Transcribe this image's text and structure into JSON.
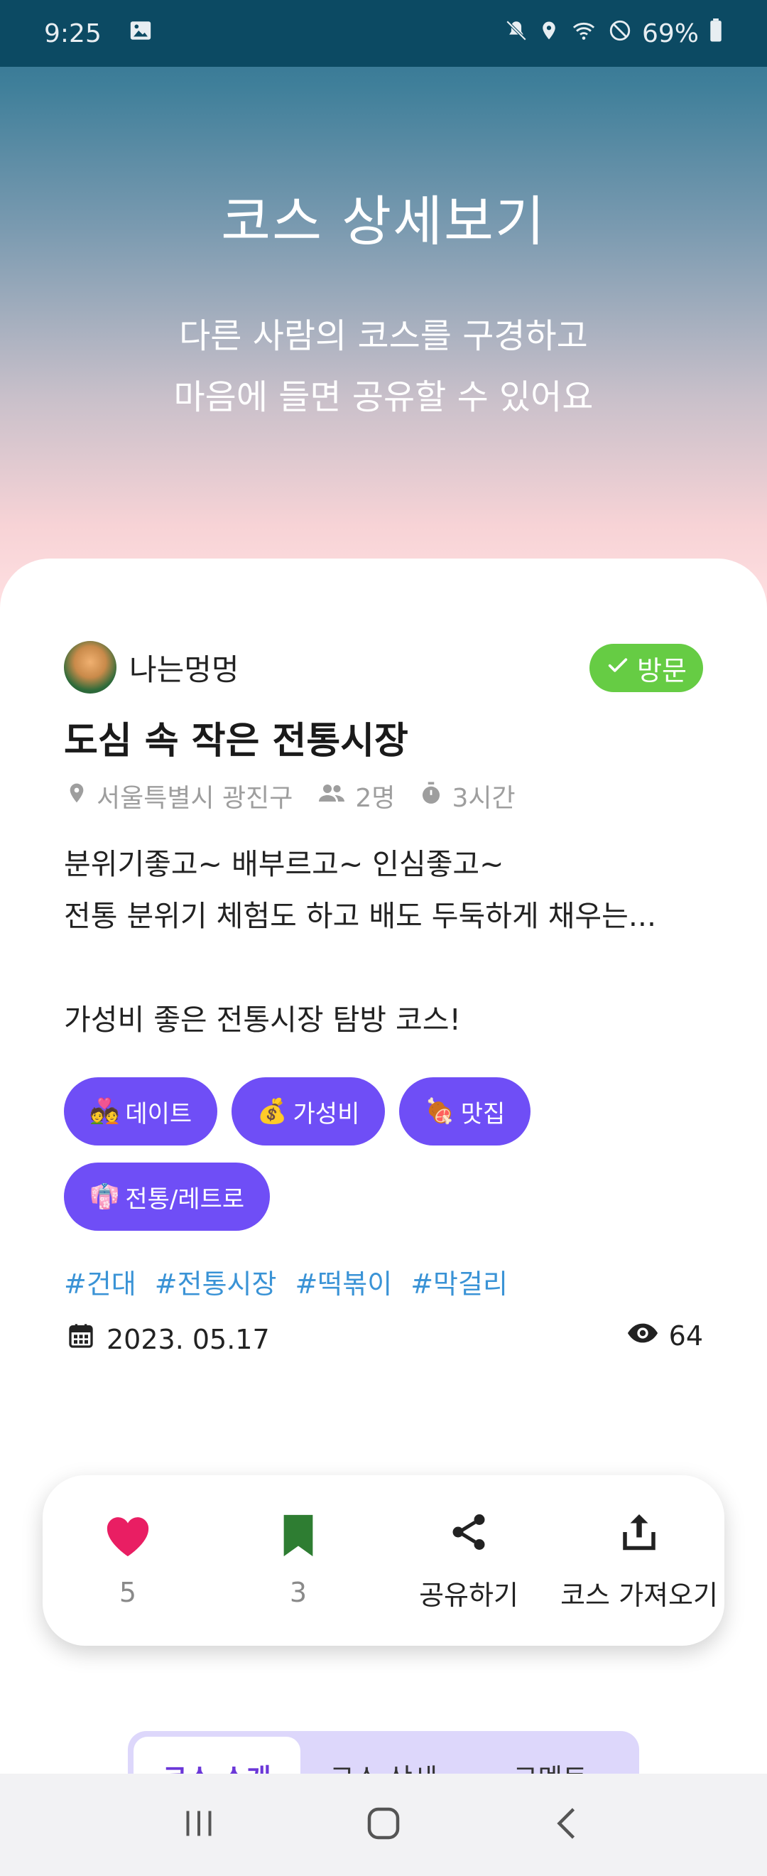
{
  "status_bar": {
    "time": "9:25",
    "battery": "69%",
    "icons": [
      "image-icon",
      "mute-icon",
      "location-icon",
      "wifi-icon",
      "dnd-icon",
      "battery-icon"
    ]
  },
  "header": {
    "title": "코스 상세보기",
    "subtitle_line1": "다른 사람의 코스를 구경하고",
    "subtitle_line2": "마음에 들면 공유할 수 있어요"
  },
  "course": {
    "author": "나는멍멍",
    "badge": "방문",
    "title": "도심 속 작은 전통시장",
    "location": "서울특별시 광진구",
    "people": "2명",
    "duration": "3시간",
    "description": "분위기좋고~ 배부르고~ 인심좋고~\n전통 분위기 체험도 하고 배도 두둑하게 채우는...\n\n가성비 좋은 전통시장 탐방 코스!",
    "categories": [
      {
        "emoji": "💑",
        "label": "데이트"
      },
      {
        "emoji": "💰",
        "label": "가성비"
      },
      {
        "emoji": "🍖",
        "label": "맛집"
      },
      {
        "emoji": "👘",
        "label": "전통/레트로"
      }
    ],
    "hashtags": [
      "#건대",
      "#전통시장",
      "#떡볶이",
      "#막걸리"
    ],
    "date": "2023. 05.17",
    "views": "64"
  },
  "actions": {
    "likes": "5",
    "bookmarks": "3",
    "share_label": "공유하기",
    "import_label": "코스 가져오기"
  },
  "tabs": [
    "코스 소개",
    "코스 상세",
    "코멘트"
  ],
  "colors": {
    "accent_purple": "#6f4ef6",
    "badge_green": "#66cc44",
    "heart_pink": "#e91e63",
    "bookmark_green": "#2e7d32",
    "hashtag_blue": "#3a93d6"
  }
}
